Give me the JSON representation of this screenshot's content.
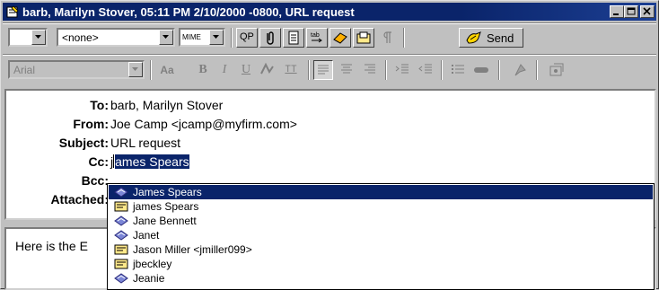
{
  "window": {
    "title": "barb, Marilyn Stover, 05:11 PM 2/10/2000 -0800, URL request"
  },
  "toolbar1": {
    "priority_value": "",
    "signature_value": "<none>",
    "encoding_value": "MIME",
    "qp_label": "QP",
    "send_label": "Send"
  },
  "toolbar2": {
    "font_value": "Arial"
  },
  "header": {
    "to_label": "To:",
    "to_value": "barb, Marilyn Stover",
    "from_label": "From:",
    "from_value": "Joe Camp <jcamp@myfirm.com>",
    "subject_label": "Subject:",
    "subject_value": "URL request",
    "cc_label": "Cc:",
    "cc_prefix": "j",
    "cc_selected": "ames Spears",
    "bcc_label": "Bcc:",
    "attached_label": "Attached:"
  },
  "body": {
    "text": "Here is the E"
  },
  "autocomplete": {
    "items": [
      {
        "name": "James Spears",
        "icon": "person-icon",
        "selected": true
      },
      {
        "name": "james Spears",
        "icon": "card-icon",
        "selected": false
      },
      {
        "name": "Jane Bennett",
        "icon": "person-icon",
        "selected": false
      },
      {
        "name": "Janet",
        "icon": "person-icon",
        "selected": false
      },
      {
        "name": "Jason Miller <jmiller099>",
        "icon": "card-icon",
        "selected": false
      },
      {
        "name": "jbeckley",
        "icon": "card-icon",
        "selected": false
      },
      {
        "name": "Jeanie",
        "icon": "person-icon",
        "selected": false
      }
    ]
  },
  "colors": {
    "titlebar": "#0a246a",
    "selection": "#0a246a",
    "face": "#c0c0c0"
  }
}
